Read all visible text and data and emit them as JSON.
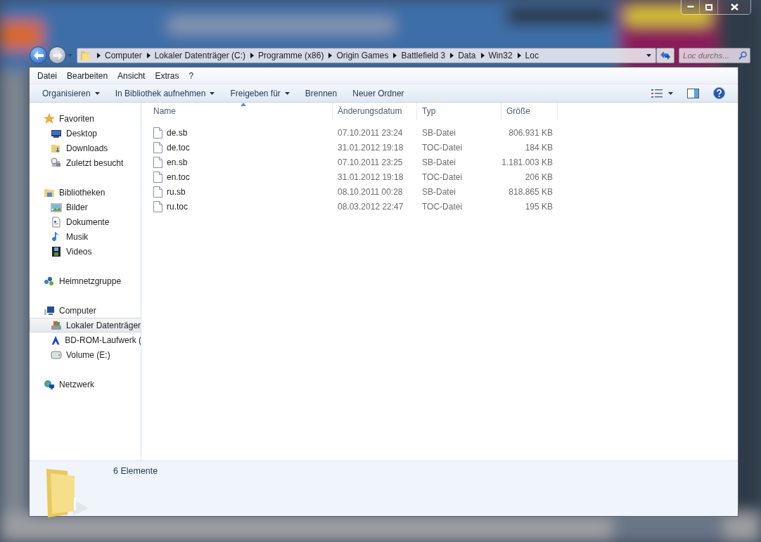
{
  "address": {
    "segments": [
      "Computer",
      "Lokaler Datenträger (C:)",
      "Programme (x86)",
      "Origin Games",
      "Battlefield 3",
      "Data",
      "Win32",
      "Loc"
    ]
  },
  "search": {
    "placeholder": "Loc durchs..."
  },
  "menu": [
    "Datei",
    "Bearbeiten",
    "Ansicht",
    "Extras",
    "?"
  ],
  "toolbar": [
    {
      "label": "Organisieren",
      "dropdown": true
    },
    {
      "label": "In Bibliothek aufnehmen",
      "dropdown": true
    },
    {
      "label": "Freigeben für",
      "dropdown": true
    },
    {
      "label": "Brennen",
      "dropdown": false
    },
    {
      "label": "Neuer Ordner",
      "dropdown": false
    }
  ],
  "sidebar": [
    {
      "label": "Favoriten",
      "selected": false,
      "children": [
        {
          "label": "Desktop",
          "selected": false
        },
        {
          "label": "Downloads",
          "selected": false
        },
        {
          "label": "Zuletzt besucht",
          "selected": false
        }
      ]
    },
    {
      "label": "Bibliotheken",
      "selected": false,
      "children": [
        {
          "label": "Bilder",
          "selected": false
        },
        {
          "label": "Dokumente",
          "selected": false
        },
        {
          "label": "Musik",
          "selected": false
        },
        {
          "label": "Videos",
          "selected": false
        }
      ]
    },
    {
      "label": "Heimnetzgruppe",
      "selected": false
    },
    {
      "label": "Computer",
      "selected": false,
      "children": [
        {
          "label": "Lokaler Datenträger",
          "selected": true
        },
        {
          "label": "BD-ROM-Laufwerk (",
          "selected": false
        },
        {
          "label": "Volume (E:)",
          "selected": false
        }
      ]
    },
    {
      "label": "Netzwerk",
      "selected": false
    }
  ],
  "table": {
    "columns": [
      {
        "label": "Name",
        "sorted": true
      },
      {
        "label": "Änderungsdatum",
        "sorted": false
      },
      {
        "label": "Typ",
        "sorted": false
      },
      {
        "label": "Größe",
        "sorted": false
      }
    ],
    "rows": [
      [
        "de.sb",
        "07.10.2011 23:24",
        "SB-Datei",
        "806.931 KB"
      ],
      [
        "de.toc",
        "31.01.2012 19:18",
        "TOC-Datei",
        "184 KB"
      ],
      [
        "en.sb",
        "07.10.2011 23:25",
        "SB-Datei",
        "1.181.003 KB"
      ],
      [
        "en.toc",
        "31.01.2012 19:18",
        "TOC-Datei",
        "206 KB"
      ],
      [
        "ru.sb",
        "08.10.2011 00:28",
        "SB-Datei",
        "818.865 KB"
      ],
      [
        "ru.toc",
        "08.03.2012 22:47",
        "TOC-Datei",
        "195 KB"
      ]
    ]
  },
  "status": {
    "text": "6 Elemente"
  }
}
